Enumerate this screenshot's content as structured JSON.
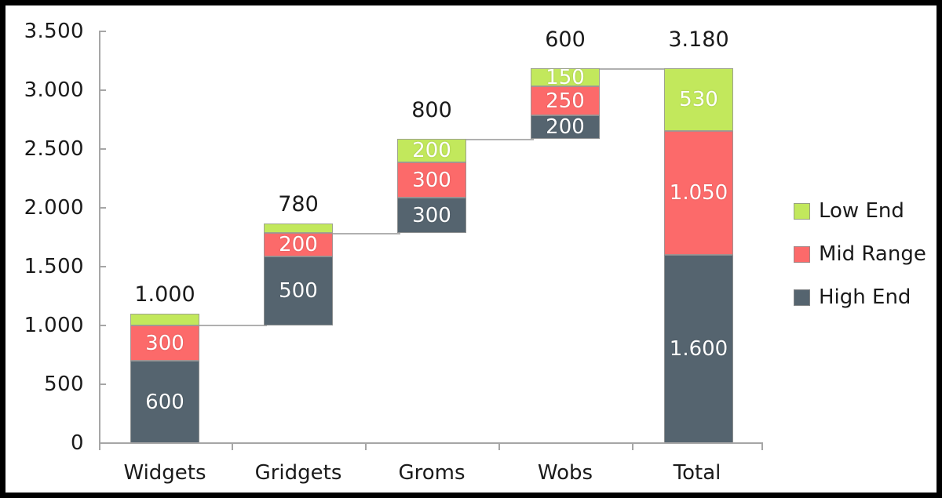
{
  "chart_data": {
    "type": "bar",
    "subtype": "stacked-waterfall",
    "title": "",
    "subtitle": "",
    "xlabel": "",
    "ylabel": "",
    "categories": [
      "Widgets",
      "Gridgets",
      "Groms",
      "Wobs",
      "Total"
    ],
    "series": [
      {
        "name": "High End",
        "color": "#55646f",
        "values": [
          600,
          500,
          300,
          200,
          1600
        ]
      },
      {
        "name": "Mid Range",
        "color": "#fc6a6a",
        "values": [
          300,
          200,
          300,
          250,
          1050
        ]
      },
      {
        "name": "Low End",
        "color": "#c2e85c",
        "values": [
          100,
          80,
          200,
          150,
          530
        ]
      }
    ],
    "stack_order_bottom_to_top": [
      "High End",
      "Mid Range",
      "Low End"
    ],
    "segment_labels": [
      {
        "category": "Widgets",
        "High End": "600",
        "Mid Range": "300",
        "Low End": ""
      },
      {
        "category": "Gridgets",
        "High End": "500",
        "Mid Range": "200",
        "Low End": ""
      },
      {
        "category": "Groms",
        "High End": "300",
        "Mid Range": "300",
        "Low End": "200"
      },
      {
        "category": "Wobs",
        "High End": "200",
        "Mid Range": "250",
        "Low End": "150"
      },
      {
        "category": "Total",
        "High End": "1.600",
        "Mid Range": "1.050",
        "Low End": "530"
      }
    ],
    "bar_totals": [
      1000,
      780,
      800,
      600,
      3180
    ],
    "bar_total_labels": [
      "1.000",
      "780",
      "800",
      "600",
      "3.180"
    ],
    "bar_bases": [
      0,
      1000,
      1780,
      2580,
      0
    ],
    "waterfall_connectors": true,
    "ylim": [
      0,
      3500
    ],
    "ytick_values": [
      0,
      500,
      1000,
      1500,
      2000,
      2500,
      3000,
      3500
    ],
    "ytick_labels": [
      "0",
      "500",
      "1.000",
      "1.500",
      "2.000",
      "2.500",
      "3.000",
      "3.500"
    ],
    "grid": false,
    "legend_position": "right",
    "legend_entries": [
      {
        "label": "Low End",
        "color": "#c2e85c"
      },
      {
        "label": "Mid Range",
        "color": "#fc6a6a"
      },
      {
        "label": "High End",
        "color": "#55646f"
      }
    ]
  },
  "colors": {
    "low_end": "#c2e85c",
    "mid_range": "#fc6a6a",
    "high_end": "#55646f",
    "axis": "#a6a6a6",
    "connector": "#b0b0b0",
    "text": "#1a1a1a",
    "segment_text": "#ffffff",
    "frame_border": "#000000",
    "plot_background": "#ffffff"
  }
}
